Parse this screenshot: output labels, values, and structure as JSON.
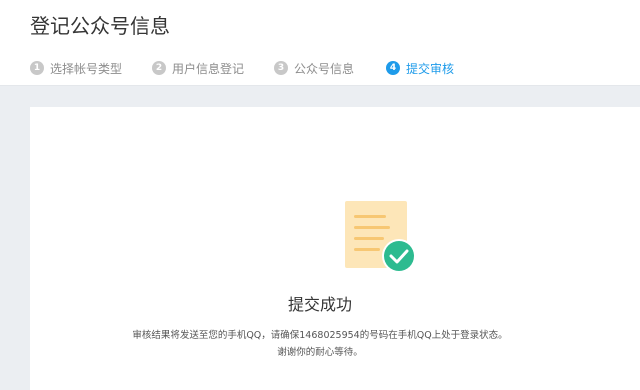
{
  "header": {
    "title": "登记公众号信息"
  },
  "steps": [
    {
      "number": "1",
      "label": "选择帐号类型",
      "active": false
    },
    {
      "number": "2",
      "label": "用户信息登记",
      "active": false
    },
    {
      "number": "3",
      "label": "公众号信息",
      "active": false
    },
    {
      "number": "4",
      "label": "提交审核",
      "active": true
    }
  ],
  "result": {
    "icon": "document-check-icon",
    "title": "提交成功",
    "message_line1": "审核结果将发送至您的手机QQ，请确保1468025954的号码在手机QQ上处于登录状态。",
    "message_line2": "谢谢你的耐心等待。"
  },
  "colors": {
    "accent": "#1e9bea",
    "success": "#2dbb90",
    "document": "#fde6b8",
    "document_lines": "#f7c773",
    "inactive_step": "#c8c8c8",
    "page_background": "#ebeef2"
  }
}
